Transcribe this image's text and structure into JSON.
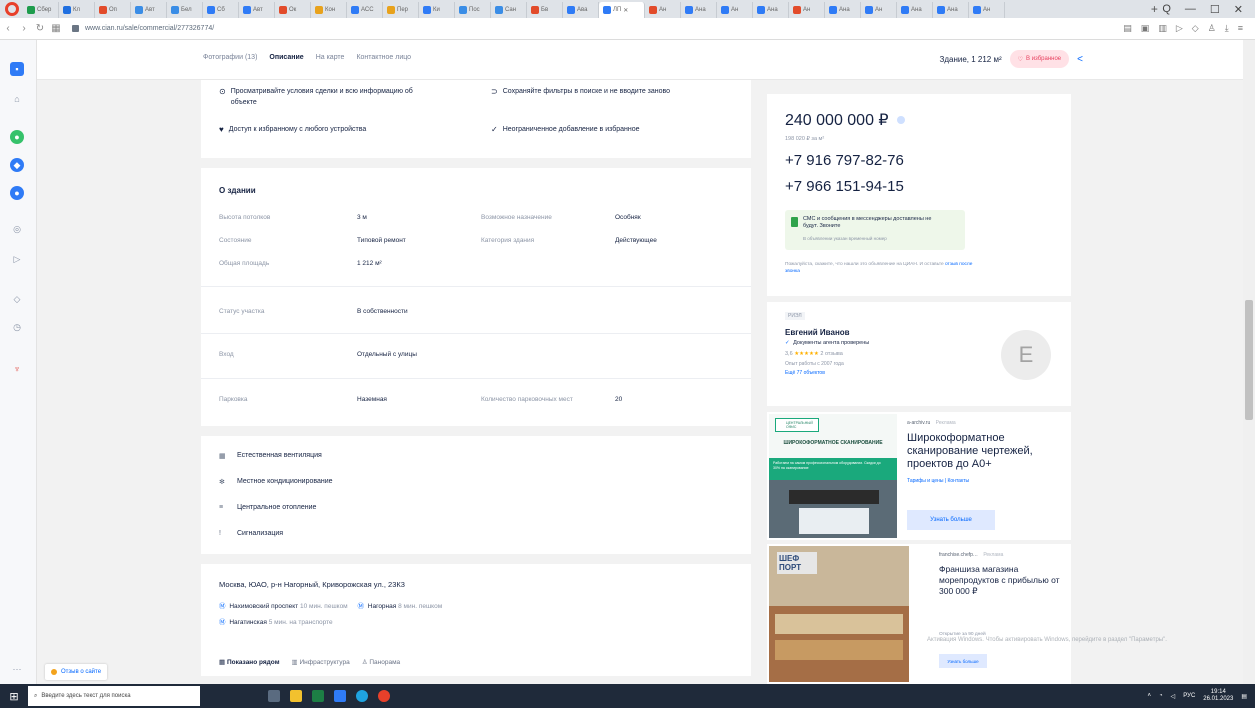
{
  "browser": {
    "tabs": [
      "Сбер",
      "Кл",
      "Оп",
      "Авт",
      "Бел",
      "Сб",
      "Авт",
      "Ок",
      "Кон",
      "АСС",
      "Пер",
      "Ки",
      "Пос",
      "Сан",
      "Бв",
      "Ава",
      "Ан",
      "Ана",
      "Ан",
      "Ана",
      "Ан",
      "Ана",
      "Ан",
      "Ана",
      "Ана",
      "Ан"
    ],
    "active_tab": "ЛП",
    "url": "www.cian.ru/sale/commercial/277326774/",
    "window_controls": [
      "Q",
      "—",
      "☐",
      "✕"
    ]
  },
  "subnav": {
    "links": [
      "Фотографии (13)",
      "Описание",
      "На карте",
      "Контактное лицо"
    ],
    "active": 1,
    "area": "Здание, 1 212 м²",
    "favorite": "В избранное"
  },
  "benefits": {
    "items": [
      {
        "icon": "eye-icon",
        "text": "Просматривайте условия сделки и всю информацию об объекте"
      },
      {
        "icon": "search-icon",
        "text": "Сохраняйте фильтры в поиске и не вводите заново"
      },
      {
        "icon": "heart-icon",
        "text": "Доступ к избранному с любого устройства"
      },
      {
        "icon": "check-icon",
        "text": "Неограниченное добавление в избранное"
      }
    ]
  },
  "about": {
    "title": "О здании",
    "left_rows": [
      {
        "label": "Высота потолков",
        "value": "3 м"
      },
      {
        "label": "Состояние",
        "value": "Типовой ремонт"
      },
      {
        "label": "Общая площадь",
        "value": "1 212 м²"
      }
    ],
    "right_rows": [
      {
        "label": "Возможное назначение",
        "value": "Особняк"
      },
      {
        "label": "Категория здания",
        "value": "Действующее"
      }
    ],
    "land": {
      "label": "Статус участка",
      "value": "В собственности"
    },
    "entrance": {
      "label": "Вход",
      "value": "Отдельный с улицы"
    },
    "parking": {
      "label": "Парковка",
      "value": "Наземная",
      "places_label": "Количество парковочных мест",
      "places_value": "20"
    }
  },
  "features": [
    {
      "icon": "ventilation-icon",
      "text": "Естественная вентиляция"
    },
    {
      "icon": "snowflake-icon",
      "text": "Местное кондиционирование"
    },
    {
      "icon": "heating-icon",
      "text": "Центральное отопление"
    },
    {
      "icon": "alarm-icon",
      "text": "Сигнализация"
    }
  ],
  "address": {
    "line": "Москва, ЮАО, р-н Нагорный, Криворожская ул., 23К3",
    "metro": [
      {
        "name": "Нахимовский проспект",
        "time": "10 мин. пешком"
      },
      {
        "name": "Нагорная",
        "time": "8 мин. пешком"
      },
      {
        "name": "Нагатинская",
        "time": "5 мин. на транспорте"
      }
    ],
    "map_tabs": [
      "Показано рядом",
      "Инфраструктура",
      "Панорама"
    ]
  },
  "price": {
    "value": "240 000 000 ₽",
    "per_m2": "198 020 ₽ за м²",
    "phones": [
      "+7 916 797-82-76",
      "+7 966 151-94-15"
    ],
    "sms_text": "СМС и сообщения в мессенджеры доставлены не будут. Звоните",
    "sms_note": "В объявлении указан временный номер",
    "disclaimer": "Пожалуйста, скажите, что нашли это объявление на ЦИАН. И оставьте",
    "disclaimer_link": "отзыв после звонка"
  },
  "agent": {
    "tag": "РИЭЛ",
    "name": "Евгений Иванов",
    "verified": "Документы агента проверены",
    "rating": "3,6",
    "stars": "★★★★★",
    "reviews": "2 отзыва",
    "experience": "Опыт работы с 2007 года",
    "more": "Ещё 77 объектов",
    "avatar_letter": "E"
  },
  "ad1": {
    "logo": "ЦЕНТРАЛЬНЫЙ ОФИС",
    "headline": "ШИРОКОФОРМАТНОЕ СКАНИРОВАНИЕ",
    "banner": "Работаем на самом профессиональном оборудовании. Скидки до 30% на сканирование",
    "source": "a-archiv.ru",
    "ad_label": "Реклама",
    "title": "Широкоформатное сканирование чертежей, проектов до А0+",
    "links": "Тарифы и цены  |  Контакты",
    "button": "Узнать больше"
  },
  "ad2": {
    "sign": "ШЕФ ПОРТ",
    "source": "franchise.chefp…",
    "ad_label": "Реклама",
    "title": "Франшиза магазина морепродуктов с прибылью от 300 000 ₽",
    "note": "Открытие за 90 дней",
    "button": "Узнать больше"
  },
  "activate_windows": "Активация Windows. Чтобы активировать Windows, перейдите в раздел \"Параметры\".",
  "feedback": "Отзыв о сайте",
  "taskbar": {
    "search": "Введите здесь текст для поиска",
    "lang": "РУС",
    "time": "19:14",
    "date": "26.01.2023"
  }
}
